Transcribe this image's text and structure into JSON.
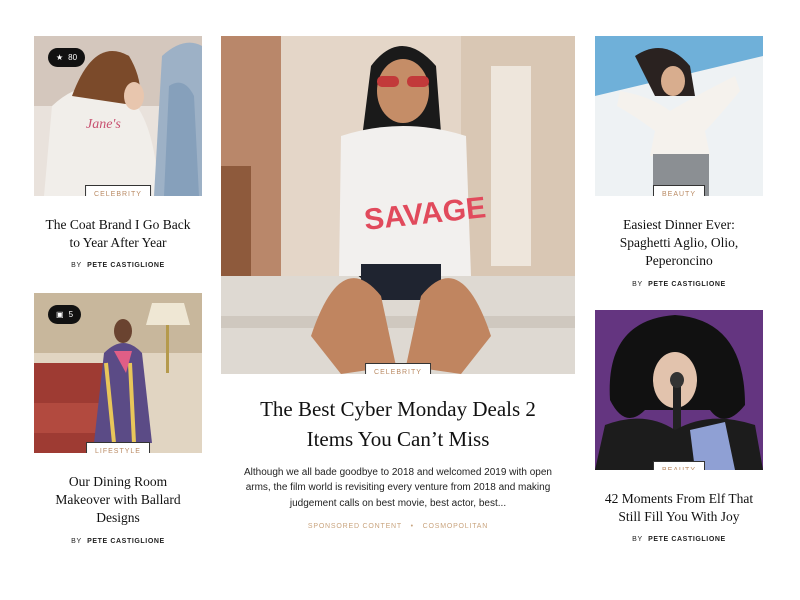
{
  "cards": {
    "left_top": {
      "badge": "Celebrity",
      "count": "80",
      "title_line1": "The Coat Brand I Go Back",
      "title_line2": "to Year After Year",
      "by": "BY",
      "author": "PETE CASTIGLIONE"
    },
    "left_bottom": {
      "badge": "Lifestyle",
      "count": "5",
      "title_line1": "Our Dining Room",
      "title_line2": "Makeover with Ballard",
      "title_line3": "Designs",
      "by": "BY",
      "author": "PETE CASTIGLIONE"
    },
    "center": {
      "badge": "Celebrity",
      "title_line1": "The Best Cyber Monday Deals 2",
      "title_line2": "Items You Can’t Miss",
      "excerpt_line1": "Although we all bade goodbye to 2018 and welcomed 2019 with open",
      "excerpt_line2": "arms, the film world is revisiting every venture from 2018 and making",
      "excerpt_line3": "judgement calls on best movie, best actor, best...",
      "meta_left": "Sponsored Content",
      "meta_sep": "•",
      "meta_right": "Cosmopolitan"
    },
    "right_top": {
      "badge": "Beauty",
      "title_line1": "Easiest Dinner Ever:",
      "title_line2": "Spaghetti Aglio, Olio,",
      "title_line3": "Peperoncino",
      "by": "BY",
      "author": "PETE CASTIGLIONE"
    },
    "right_bottom": {
      "badge": "Beauty",
      "title_line1": "42 Moments From Elf That",
      "title_line2": "Still Fill You With Joy",
      "by": "BY",
      "author": "PETE CASTIGLIONE"
    }
  },
  "icons": {
    "star": "star-icon",
    "gallery": "gallery-icon"
  },
  "colors": {
    "accent": "#c9a47e",
    "badge_text": "#b98a63",
    "ink": "#111111"
  }
}
